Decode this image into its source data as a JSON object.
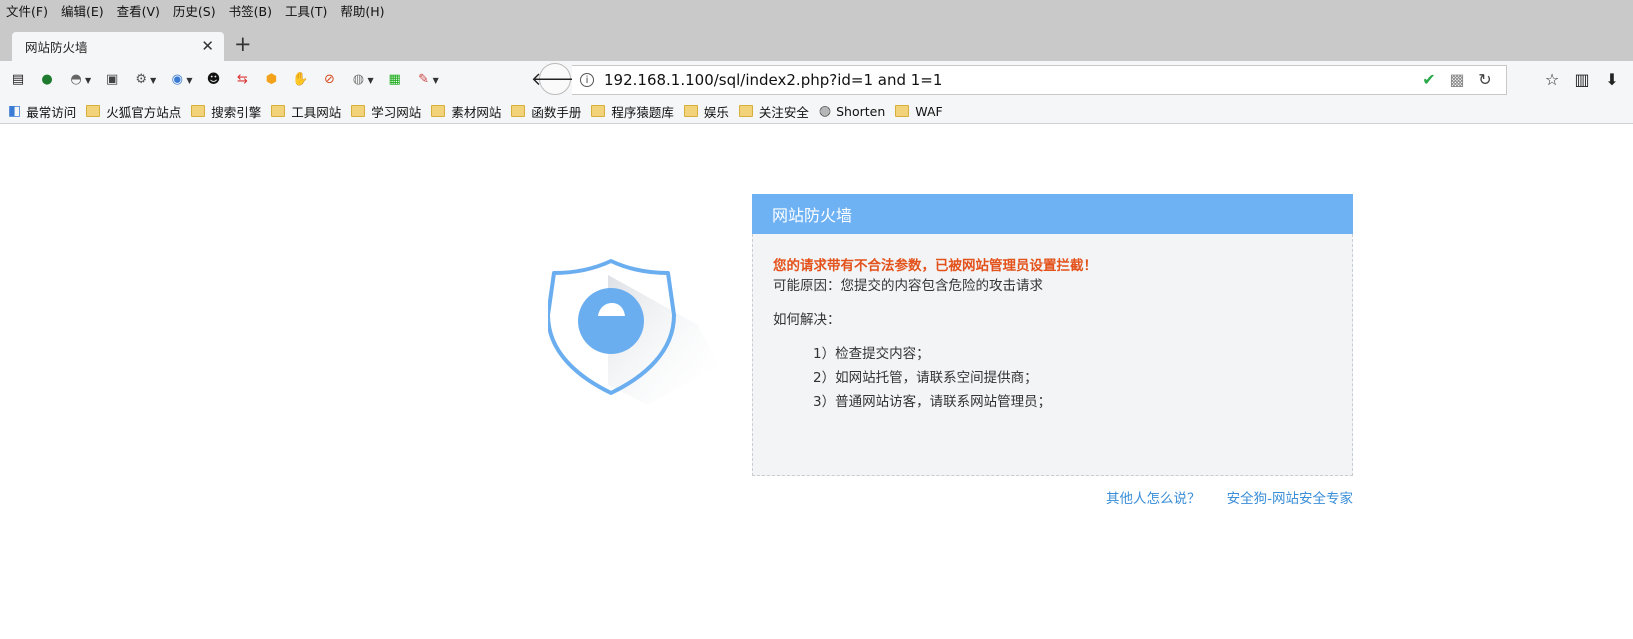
{
  "menubar": {
    "items": [
      "文件(F)",
      "编辑(E)",
      "查看(V)",
      "历史(S)",
      "书签(B)",
      "工具(T)",
      "帮助(H)"
    ]
  },
  "tab": {
    "title": "网站防火墙",
    "close_glyph": "✕",
    "new_tab_glyph": "+"
  },
  "toolbar": {
    "icons": [
      {
        "name": "sidebar-icon",
        "glyph": "▤",
        "color": "#222"
      },
      {
        "name": "shield-addon-icon",
        "glyph": "●",
        "color": "#1e7a2e"
      },
      {
        "name": "screenshot-addon-icon",
        "glyph": "◓",
        "color": "#666",
        "dropdown": true
      },
      {
        "name": "reader-icon",
        "glyph": "▣",
        "color": "#444"
      },
      {
        "name": "settings-gear-icon",
        "glyph": "⚙",
        "color": "#555",
        "dropdown": true
      },
      {
        "name": "chrome-addon-icon",
        "glyph": "◉",
        "color": "#3a7bd5",
        "dropdown": true
      },
      {
        "name": "ghost-addon-icon",
        "glyph": "☻",
        "color": "#111"
      },
      {
        "name": "swap-arrows-icon",
        "glyph": "⇆",
        "color": "#d33"
      },
      {
        "name": "ip-badge-icon",
        "glyph": "⬢",
        "color": "#f2a31b"
      },
      {
        "name": "hand-icon",
        "glyph": "✋",
        "color": "#bbb"
      },
      {
        "name": "block-icon",
        "glyph": "⊘",
        "color": "#d64a1f"
      },
      {
        "name": "proxy-addon-icon",
        "glyph": "◍",
        "color": "#777",
        "dropdown": true
      },
      {
        "name": "terminal-addon-icon",
        "glyph": "▦",
        "color": "#1a1"
      },
      {
        "name": "tools-addon-icon",
        "glyph": "✎",
        "color": "#c44",
        "dropdown": true
      }
    ],
    "back_glyph": "🡐",
    "url": "192.168.1.100/sql/index2.php?id=1 and 1=1",
    "info_glyph": "i",
    "url_right_icons": [
      {
        "name": "shield-check-icon",
        "glyph": "✔",
        "color": "#2aa84a"
      },
      {
        "name": "qr-code-icon",
        "glyph": "▩",
        "color": "#888"
      },
      {
        "name": "reload-icon",
        "glyph": "↻",
        "color": "#444"
      }
    ],
    "right_icons": [
      {
        "name": "bookmark-star-icon",
        "glyph": "☆",
        "color": "#222"
      },
      {
        "name": "library-icon",
        "glyph": "▥",
        "color": "#222"
      },
      {
        "name": "download-icon",
        "glyph": "⬇",
        "color": "#222"
      }
    ]
  },
  "bookmarks": [
    {
      "label": "最常访问",
      "type": "smart"
    },
    {
      "label": "火狐官方站点",
      "type": "folder"
    },
    {
      "label": "搜索引擎",
      "type": "folder"
    },
    {
      "label": "工具网站",
      "type": "folder"
    },
    {
      "label": "学习网站",
      "type": "folder"
    },
    {
      "label": "素材网站",
      "type": "folder"
    },
    {
      "label": "函数手册",
      "type": "folder"
    },
    {
      "label": "程序猿题库",
      "type": "folder"
    },
    {
      "label": "娱乐",
      "type": "folder"
    },
    {
      "label": "关注安全",
      "type": "folder"
    },
    {
      "label": "Shorten",
      "type": "globe"
    },
    {
      "label": "WAF",
      "type": "folder"
    }
  ],
  "firewall": {
    "header": "网站防火墙",
    "warning": "您的请求带有不合法参数，已被网站管理员设置拦截！",
    "reason": "可能原因：您提交的内容包含危险的攻击请求",
    "howto": "如何解决：",
    "steps": [
      "1）检查提交内容；",
      "2）如网站托管，请联系空间提供商；",
      "3）普通网站访客，请联系网站管理员；"
    ],
    "links": [
      "其他人怎么说？",
      "安全狗-网站安全专家"
    ],
    "colors": {
      "header_bg": "#6eb2f4",
      "warning": "#e4521b",
      "link": "#3a8ed8",
      "shield": "#6aaef0"
    }
  }
}
